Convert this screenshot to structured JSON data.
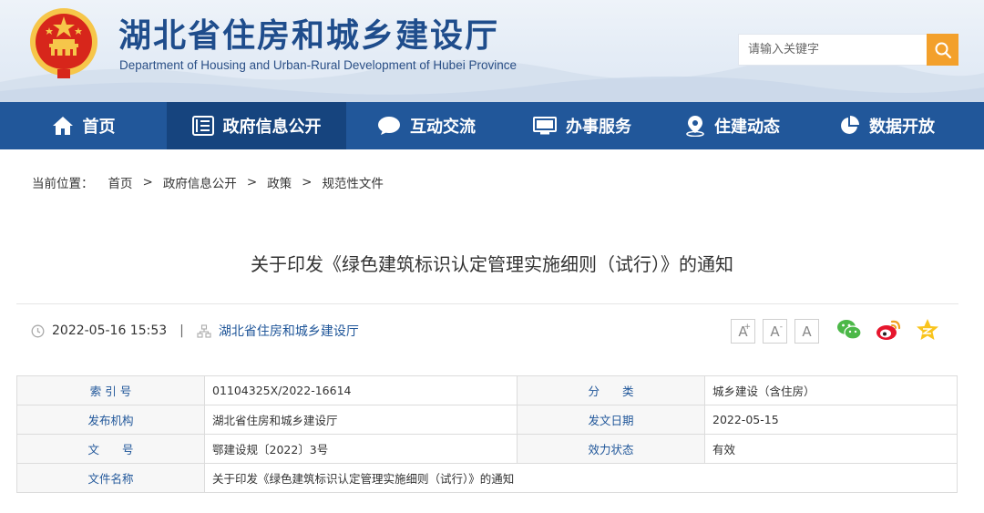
{
  "site": {
    "title": "湖北省住房和城乡建设厅",
    "subtitle": "Department of Housing and Urban-Rural Development of Hubei Province",
    "emblem": "national-emblem"
  },
  "search": {
    "placeholder": "请输入关键字",
    "icon": "search-icon"
  },
  "nav": [
    {
      "label": "首页",
      "icon": "home-icon"
    },
    {
      "label": "政府信息公开",
      "icon": "document-list-icon",
      "active": true
    },
    {
      "label": "互动交流",
      "icon": "chat-bubble-icon"
    },
    {
      "label": "办事服务",
      "icon": "monitor-icon"
    },
    {
      "label": "住建动态",
      "icon": "location-pin-icon"
    },
    {
      "label": "数据开放",
      "icon": "pie-chart-icon"
    }
  ],
  "breadcrumb": {
    "prefix": "当前位置：",
    "items": [
      "首页",
      "政府信息公开",
      "政策",
      "规范性文件"
    ],
    "separator": ">"
  },
  "article": {
    "title": "关于印发《绿色建筑标识认定管理实施细则（试行）》的通知",
    "datetime": "2022-05-16 15:53",
    "divider": "|",
    "source": "湖北省住房和城乡建设厅"
  },
  "font_size_buttons": [
    "A",
    "A",
    "A"
  ],
  "share_icons": [
    "wechat-icon",
    "weibo-icon",
    "qzone-icon"
  ],
  "info_table": {
    "index_label": "索 引 号",
    "index_value": "01104325X/2022-16614",
    "category_label": "分　　类",
    "category_value": "城乡建设（含住房）",
    "issuer_label": "发布机构",
    "issuer_value": "湖北省住房和城乡建设厅",
    "date_label": "发文日期",
    "date_value": "2022-05-15",
    "docno_label": "文　　号",
    "docno_value": "鄂建设规〔2022〕3号",
    "status_label": "效力状态",
    "status_value": "有效",
    "name_label": "文件名称",
    "name_value": "关于印发《绿色建筑标识认定管理实施细则（试行）》的通知"
  },
  "colors": {
    "nav_bg": "#21579a",
    "nav_active": "#16447e",
    "accent": "#f3a02b",
    "title_blue": "#1f4d8c",
    "emblem_red": "#d7261b",
    "emblem_gold": "#f6c64a"
  }
}
